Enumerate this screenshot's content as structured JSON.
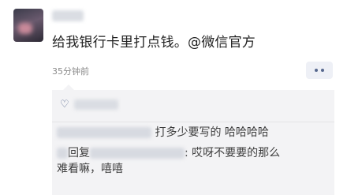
{
  "post": {
    "text": "给我银行卡里打点钱。@微信官方",
    "time": "35分钟前"
  },
  "comments": [
    {
      "name_tail": "",
      "text": "打多少要写的 哈哈哈哈"
    },
    {
      "reply_label": "回复",
      "text_line1": ": 哎呀不要要的那么",
      "text_line2": "难看嘛，嘻嘻"
    }
  ],
  "icons": {
    "like": "heart-icon",
    "more": "more-dots-icon"
  },
  "colors": {
    "link": "#57688e",
    "box": "#f3f3f5"
  }
}
